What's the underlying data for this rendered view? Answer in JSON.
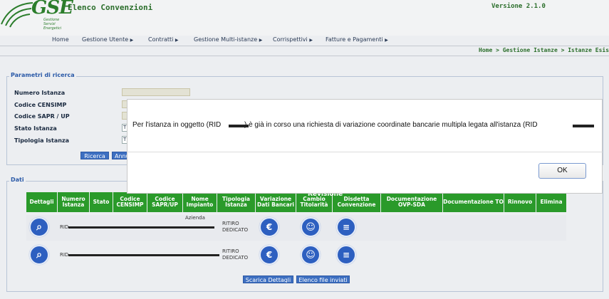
{
  "header": {
    "logo": "GSE",
    "logo_sub": [
      "Gestione",
      "Servizi",
      "Energetici"
    ],
    "app_title": "Elenco Convenzioni",
    "version": "Versione 2.1.0"
  },
  "nav": {
    "items": [
      {
        "label": "Home"
      },
      {
        "label": "Gestione Utente"
      },
      {
        "label": "Contratti"
      },
      {
        "label": "Gestione Multi-istanze"
      },
      {
        "label": "Corrispettivi"
      },
      {
        "label": "Fatture e Pagamenti"
      }
    ],
    "arrow": "▶"
  },
  "breadcrumb": "Home > Gestione Istanze > Istanze Esistenti",
  "search": {
    "legend": "Parametri di ricerca",
    "fields": [
      {
        "label": "Numero Istanza"
      },
      {
        "label": "Codice CENSIMP"
      },
      {
        "label": "Codice SAPR / UP"
      },
      {
        "label": "Stato Istanza"
      },
      {
        "label": "Tipologia Istanza"
      }
    ],
    "select_stub": "T",
    "buttons": {
      "search": "Ricerca",
      "reset": "Annu"
    }
  },
  "data_section": {
    "legend": "Dati",
    "columns": [
      "Dettagli",
      "Numero Istanza",
      "Stato",
      "Codice CENSIMP",
      "Codice SAPR/UP",
      "Nome Impianto",
      "Tipologia Istanza",
      "Variazione Dati Bancari",
      "Cambio Titolarità",
      "Disdetta Convenzione",
      "Documentazione OVP-SDA",
      "Documentazione TO",
      "Rinnovo",
      "Elimina"
    ],
    "overlay_text": "Revisione",
    "rows": [
      {
        "numero": "RID",
        "nome_top": "Azienda",
        "tipologia": "RITIRO DEDICATO"
      },
      {
        "numero": "RID",
        "nome_top": "",
        "tipologia": "RITIRO DEDICATO"
      }
    ],
    "buttons": {
      "download": "Scarica Dettagli",
      "sent": "Elenco file inviati"
    }
  },
  "modal": {
    "message": "Per l'istanza in oggetto (RID    ) è già in corso una richiesta di variazione coordinate bancarie multipla legata all'istanza (RID",
    "ok": "OK"
  },
  "colors": {
    "accent_green": "#2a9a2a",
    "button_blue": "#3d6fc1",
    "legend_blue": "#2b5aa8"
  }
}
